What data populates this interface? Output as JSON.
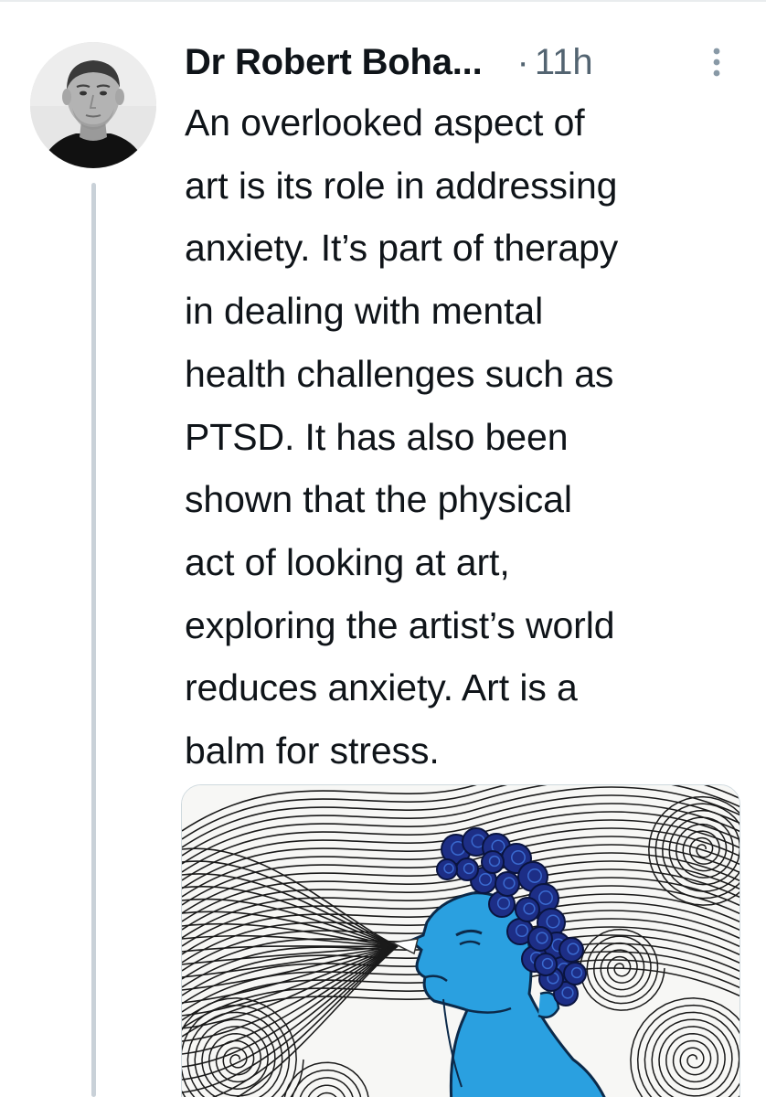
{
  "tweet": {
    "author": {
      "display_name": "Dr Robert Boha...",
      "avatar_icon": "profile-photo"
    },
    "separator": "·",
    "timestamp": "11h",
    "more_icon": "more-vertical-icon",
    "text": "An overlooked aspect of\nart is its role in addressing\nanxiety. It’s part of therapy\nin dealing with mental\nhealth challenges such as\nPTSD. It has also been\nshown that the physical\nact of looking at art,\nexploring the artist’s world\nreduces anxiety. Art is a\nbalm for stress.",
    "media": {
      "type": "image",
      "subject": "drawing of blue figure exhaling amid swirling lines"
    }
  },
  "colors": {
    "text_primary": "#0f1419",
    "text_secondary": "#536471",
    "thread_line": "#c9d1d8",
    "art_blue": "#2aa0e0",
    "art_hair": "#1d2e86"
  }
}
